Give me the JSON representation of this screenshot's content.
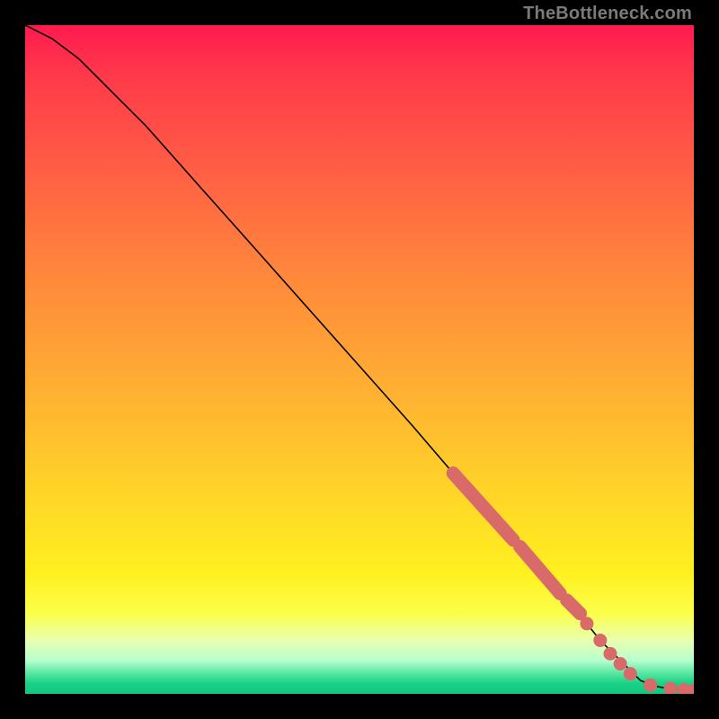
{
  "watermark": "TheBottleneck.com",
  "chart_data": {
    "type": "line",
    "title": "",
    "xlabel": "",
    "ylabel": "",
    "xlim": [
      0,
      100
    ],
    "ylim": [
      0,
      100
    ],
    "curve": {
      "x": [
        0,
        4,
        8,
        12,
        18,
        26,
        34,
        42,
        50,
        58,
        64,
        70,
        76,
        82,
        86,
        90,
        92,
        94,
        96,
        98,
        100
      ],
      "y": [
        100,
        98,
        95,
        91,
        85,
        76,
        67,
        58,
        49,
        40,
        33,
        27,
        20,
        13,
        8,
        4,
        2,
        1.2,
        0.8,
        0.6,
        0.5
      ]
    },
    "marker_segments": [
      {
        "x0": 64,
        "y0": 33,
        "x1": 73,
        "y1": 23
      },
      {
        "x0": 74,
        "y0": 22,
        "x1": 80,
        "y1": 15
      },
      {
        "x0": 81,
        "y0": 14,
        "x1": 83,
        "y1": 12
      }
    ],
    "marker_points": [
      {
        "x": 84,
        "y": 10.5
      },
      {
        "x": 86,
        "y": 8.0
      },
      {
        "x": 87.5,
        "y": 6.0
      },
      {
        "x": 89,
        "y": 4.5
      },
      {
        "x": 90.5,
        "y": 3.0
      },
      {
        "x": 93.5,
        "y": 1.3
      },
      {
        "x": 96.5,
        "y": 0.8
      },
      {
        "x": 98.5,
        "y": 0.6
      },
      {
        "x": 100,
        "y": 0.5
      }
    ],
    "marker_color": "#d96a6a"
  }
}
